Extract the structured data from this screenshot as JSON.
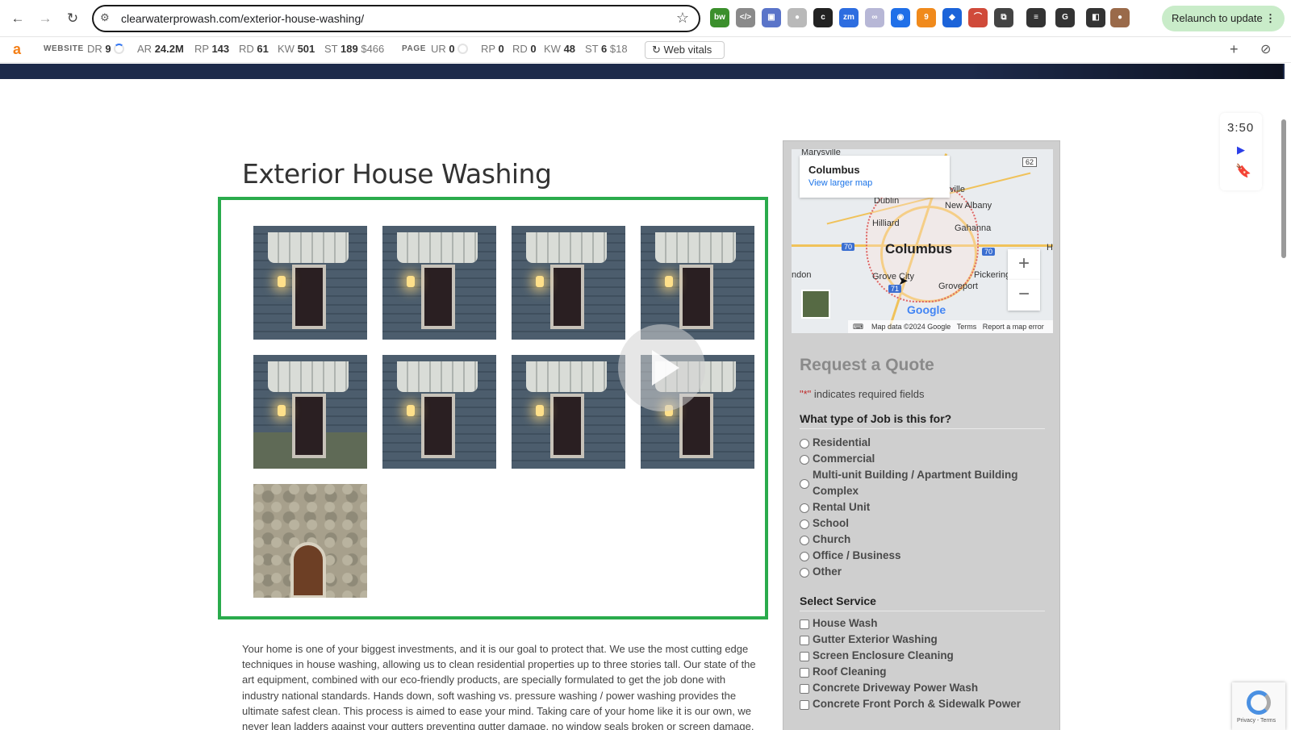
{
  "browser": {
    "url": "clearwaterprowash.com/exterior-house-washing/",
    "relaunch_label": "Relaunch to update",
    "relaunch_menu": "⋮",
    "back_glyph": "←",
    "forward_glyph": "→",
    "reload_glyph": "↻",
    "site_info_glyph": "⚙",
    "star_glyph": "☆",
    "extensions": [
      {
        "icon": "bw-extension-icon",
        "color": "#3b8f2c",
        "label": "bw"
      },
      {
        "icon": "code-extension-icon",
        "color": "#8a8a8a",
        "label": "</>"
      },
      {
        "icon": "window-extension-icon",
        "color": "#5a74c9",
        "label": "▣"
      },
      {
        "icon": "grey-extension-icon",
        "color": "#b9b9b9",
        "label": "●"
      },
      {
        "icon": "c-extension-icon",
        "color": "#222222",
        "label": "c"
      },
      {
        "icon": "zm-extension-icon",
        "color": "#2d6de0",
        "label": "zm"
      },
      {
        "icon": "link-extension-icon",
        "color": "#b7b7d6",
        "label": "∞"
      },
      {
        "icon": "circle-extension-icon",
        "color": "#1f6fe8",
        "label": "◉"
      },
      {
        "icon": "badge-extension-icon",
        "color": "#f08a1c",
        "label": "9"
      },
      {
        "icon": "dropbox-icon",
        "color": "#1b63d9",
        "label": "◆"
      },
      {
        "icon": "curve-extension-icon",
        "color": "#d04a3a",
        "label": "⌒"
      },
      {
        "icon": "puzzle-icon",
        "color": "#444444",
        "label": "⧉"
      },
      {
        "icon": "media-icon",
        "color": "#333333",
        "label": "≡"
      },
      {
        "icon": "google-icon",
        "color": "#333333",
        "label": "G"
      },
      {
        "icon": "sidepanel-icon",
        "color": "#333333",
        "label": "◧"
      },
      {
        "icon": "profile-avatar-icon",
        "color": "#9a6a4a",
        "label": "●"
      }
    ]
  },
  "ahrefs": {
    "logo": "a",
    "website_label": "WEBSITE",
    "page_label": "PAGE",
    "web_vitals_glyph": "↻",
    "plus_glyph": "+",
    "disable_glyph": "⊘",
    "website_metrics": [
      {
        "k": "DR",
        "v": "9",
        "ring": true
      },
      {
        "k": "AR",
        "v": "24.2M"
      },
      {
        "k": "RP",
        "v": "143"
      },
      {
        "k": "RD",
        "v": "61"
      },
      {
        "k": "KW",
        "v": "501"
      },
      {
        "k": "ST",
        "v": "189",
        "extra": "$466"
      }
    ],
    "page_metrics": [
      {
        "k": "UR",
        "v": "0",
        "ring": true
      },
      {
        "k": "RP",
        "v": "0"
      },
      {
        "k": "RD",
        "v": "0"
      },
      {
        "k": "KW",
        "v": "48"
      },
      {
        "k": "ST",
        "v": "6",
        "extra": "$18"
      }
    ],
    "web_vitals": "Web vitals"
  },
  "page": {
    "title": "Exterior House Washing",
    "gallery_count": 9,
    "body_text": "Your home is one of your biggest investments, and it is our goal to protect that. We use the most cutting edge techniques in house washing, allowing us to clean residential properties up to three stories tall. Our state of the art equipment, combined with our eco-friendly products, are specially formulated to get the job done with industry national standards. Hands down, soft washing vs. pressure washing / power washing provides the ultimate safest clean. This process is aimed to ease your mind. Taking care of your home like it is our own, we never lean ladders against your gutters preventing gutter damage, no window seals broken or screen damage."
  },
  "map": {
    "card_title": "Columbus",
    "card_link": "View larger map",
    "places": {
      "marysville": "Marysville",
      "dublin": "Dublin",
      "ville": "ville",
      "new_albany": "New Albany",
      "hilliard": "Hilliard",
      "gahanna": "Gahanna",
      "columbus": "Columbus",
      "ndon": "ndon",
      "grove_city": "Grove City",
      "pickerington": "Pickerington",
      "groveport": "Groveport",
      "h": "H"
    },
    "highways": {
      "i70_west": "70",
      "i70_east": "70",
      "i71": "71",
      "us62": "62"
    },
    "google_logo": "Google",
    "keyboard_glyph": "⌨",
    "footer_data": "Map data ©2024 Google",
    "footer_terms": "Terms",
    "footer_report": "Report a map error",
    "zoom_in": "+",
    "zoom_out": "−",
    "cursor_glyph": "➤"
  },
  "form": {
    "title": "Request a Quote",
    "required_star": "\"*\"",
    "required_note": "indicates required fields",
    "job_question": "What type of Job is this for?",
    "job_options": [
      "Residential",
      "Commercial",
      "Multi-unit Building / Apartment Building",
      "Complex",
      "Rental Unit",
      "School",
      "Church",
      "Office / Business",
      "Other"
    ],
    "service_question": "Select Service",
    "service_options": [
      "House Wash",
      "Gutter Exterior Washing",
      "Screen Enclosure Cleaning",
      "Roof Cleaning",
      "Concrete Driveway Power Wash",
      "Concrete Front Porch & Sidewalk Power"
    ]
  },
  "rail": {
    "time": "3:50",
    "play_glyph": "▶",
    "bookmark_glyph": "🔖"
  },
  "recaptcha": {
    "terms": "Privacy - Terms"
  }
}
